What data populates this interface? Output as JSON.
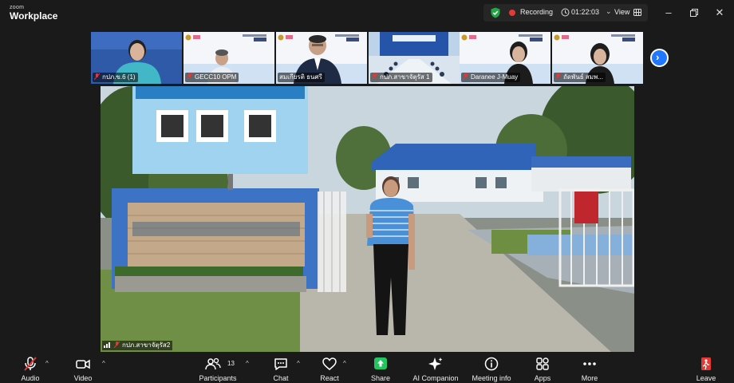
{
  "app": {
    "brand_top": "zoom",
    "brand_bottom": "Workplace"
  },
  "recording": {
    "label": "Recording",
    "timer": "01:22:03",
    "view_label": "View"
  },
  "colors": {
    "accent": "#1f78ff",
    "record": "#e53935",
    "shield": "#23a845",
    "share": "#22c55e",
    "leave": "#e53935"
  },
  "participants": [
    {
      "name": "กปภ.ข.6 (1)"
    },
    {
      "name": "GECC10 OPM"
    },
    {
      "name": "สมเกียรติ ธนศรี"
    },
    {
      "name": "กปภ.สาขาจัตุรัส 1"
    },
    {
      "name": "Daranee J-Muay"
    },
    {
      "name": "ถัดพันธ์ สมพ..."
    }
  ],
  "main_video": {
    "name": "กปภ.สาขาจัตุรัส2"
  },
  "toolbar": {
    "audio": "Audio",
    "video": "Video",
    "participants": "Participants",
    "participants_count": "13",
    "chat": "Chat",
    "react": "React",
    "share": "Share",
    "ai_companion": "AI Companion",
    "meeting_info": "Meeting info",
    "apps": "Apps",
    "more": "More",
    "leave": "Leave"
  }
}
